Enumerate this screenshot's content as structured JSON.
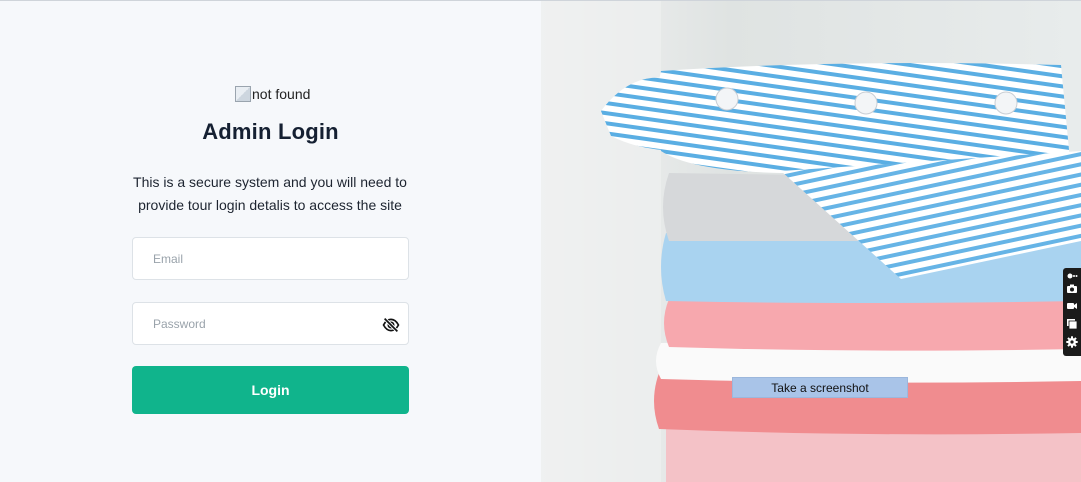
{
  "login": {
    "logo_alt": "not found",
    "title": "Admin Login",
    "description": "This is a secure system and you will need to provide tour login detalis to access the site",
    "email_placeholder": "Email",
    "password_placeholder": "Password",
    "login_label": "Login"
  },
  "colors": {
    "background": "#f6f8fb",
    "accent": "#10b48c",
    "title": "#152032"
  },
  "screenshot_tool": {
    "tooltip": "Take a screenshot",
    "icons": [
      "pin-icon",
      "camera-icon",
      "video-camera-icon",
      "gallery-icon",
      "gear-icon"
    ]
  },
  "hero_image": {
    "subject": "stack of folded shirts"
  }
}
